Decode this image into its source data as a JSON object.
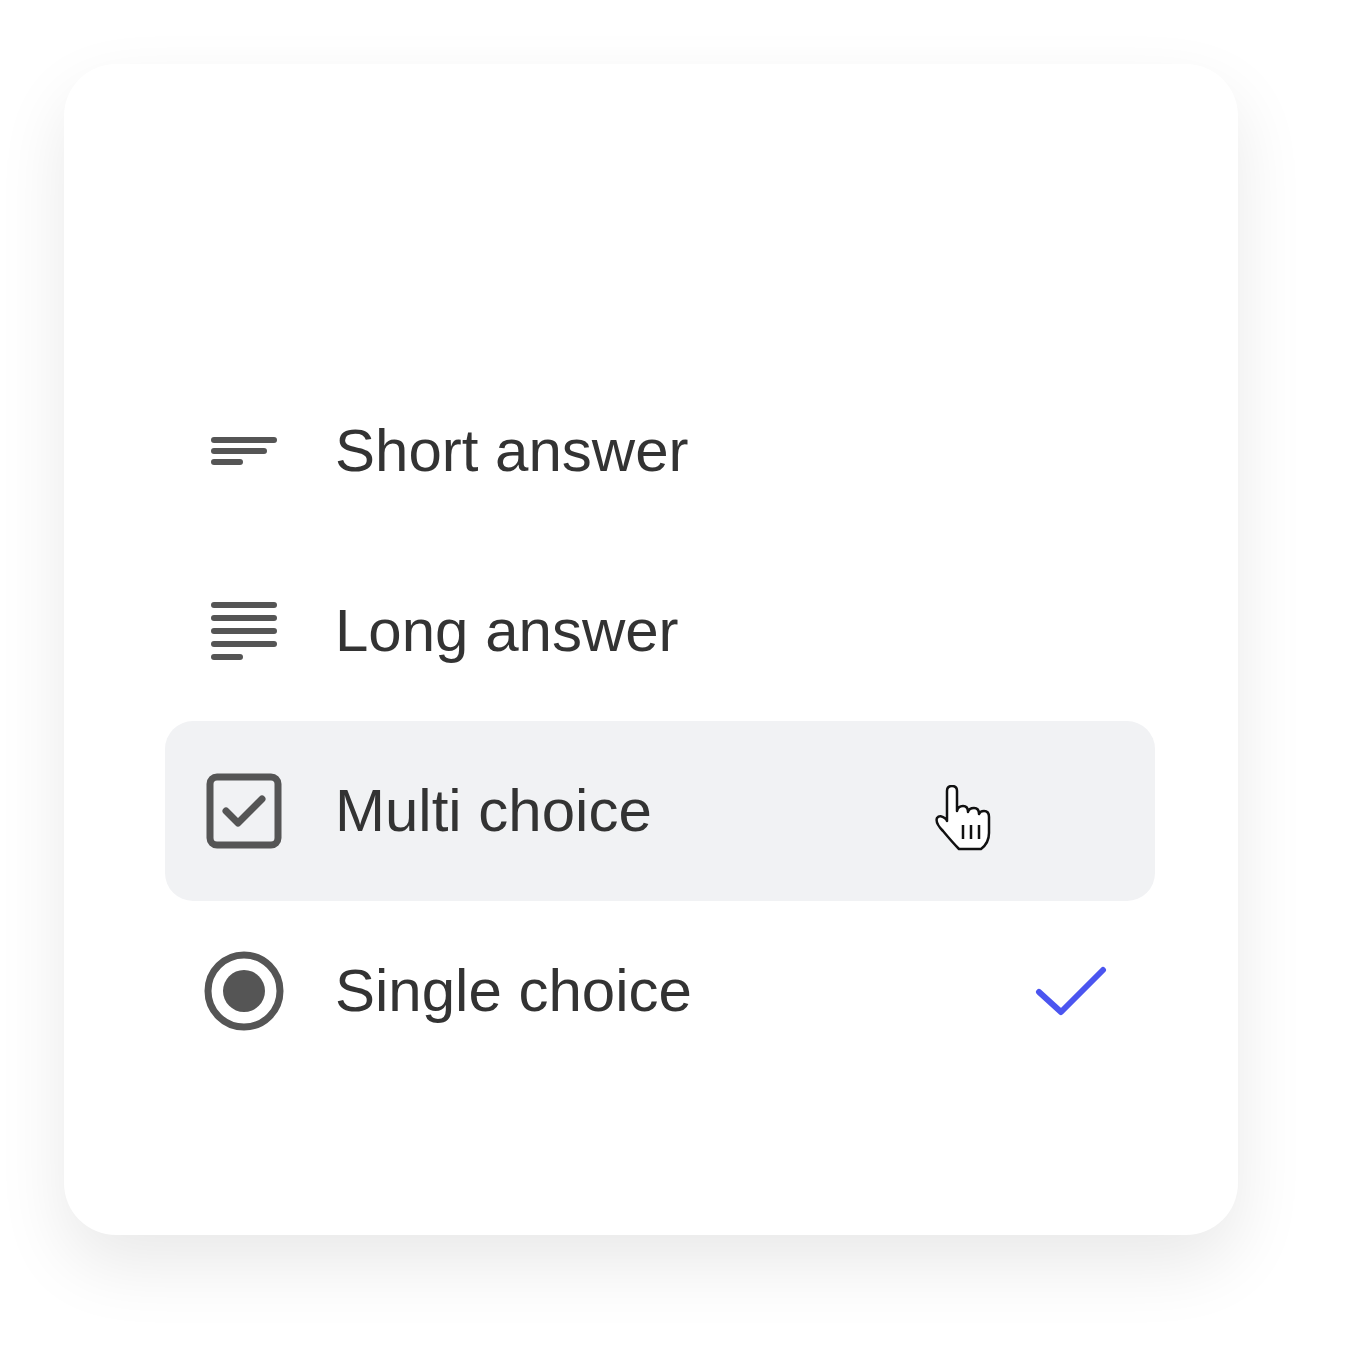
{
  "menu": {
    "items": [
      {
        "kind": "short",
        "label": "Short answer",
        "hovered": false,
        "selected": false
      },
      {
        "kind": "long",
        "label": "Long answer",
        "hovered": false,
        "selected": false
      },
      {
        "kind": "checkbox",
        "label": "Multi choice",
        "hovered": true,
        "selected": false
      },
      {
        "kind": "radio",
        "label": "Single choice",
        "hovered": false,
        "selected": true
      }
    ]
  }
}
